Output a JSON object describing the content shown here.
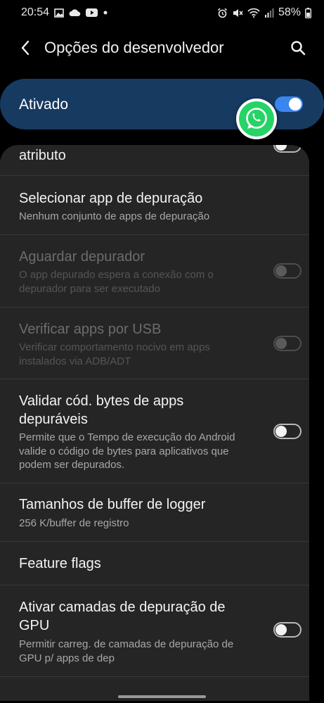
{
  "status_bar": {
    "time": "20:54",
    "battery": "58%",
    "left_icons": [
      "image-icon",
      "cloud-icon",
      "youtube-icon",
      "dot-icon"
    ],
    "right_icons": [
      "alarm-icon",
      "mute-icon",
      "wifi-icon",
      "signal-icon",
      "battery-icon"
    ]
  },
  "app_bar": {
    "title": "Opções do desenvolvedor"
  },
  "master": {
    "label": "Ativado",
    "checked": true
  },
  "colors": {
    "accent": "#3a86f0",
    "master_bg": "#173a61",
    "card_bg": "#252525",
    "whatsapp": "#25d366"
  },
  "list": {
    "items": [
      {
        "title": "atributo",
        "summary": "",
        "toggle": "off"
      },
      {
        "title": "Selecionar app de depuração",
        "summary": "Nenhum conjunto de apps de depuração",
        "toggle": "none"
      },
      {
        "title": "Aguardar depurador",
        "summary": "O app depurado espera a conexão com o depurador para ser executado",
        "toggle": "disabled"
      },
      {
        "title": "Verificar apps por USB",
        "summary": "Verificar comportamento nocivo em apps instalados via ADB/ADT",
        "toggle": "disabled"
      },
      {
        "title": "Validar cód. bytes de apps depuráveis",
        "summary": "Permite que o Tempo de execução do Android valide o código de bytes para aplicativos que podem ser depurados.",
        "toggle": "off"
      },
      {
        "title": "Tamanhos de buffer de logger",
        "summary": "256 K/buffer de registro",
        "toggle": "none"
      },
      {
        "title": "Feature flags",
        "summary": "",
        "toggle": "none"
      },
      {
        "title": "Ativar camadas de depuração de GPU",
        "summary": "Permitir carreg. de camadas de depuração de GPU p/ apps de dep",
        "toggle": "off"
      }
    ]
  }
}
